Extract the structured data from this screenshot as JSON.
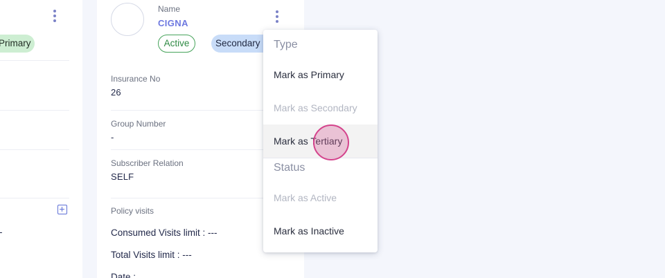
{
  "left_card": {
    "badge_label": "Primary",
    "visits_limit_fragment": "---"
  },
  "main_card": {
    "name_label": "Name",
    "name_value": "CIGNA",
    "status_badge": "Active",
    "type_badge": "Secondary",
    "fields": {
      "insurance_no_label": "Insurance No",
      "insurance_no_value": "26",
      "group_number_label": "Group Number",
      "group_number_value": "-",
      "subscriber_relation_label": "Subscriber Relation",
      "subscriber_relation_value": "SELF",
      "policy_visits_label": "Policy visits"
    },
    "consumed_visits": "Consumed Visits limit : ---",
    "total_visits": "Total Visits limit : ---",
    "date": "Date :"
  },
  "menu": {
    "type_header": "Type",
    "items_type": [
      {
        "label": "Mark as Primary",
        "enabled": true
      },
      {
        "label": "Mark as Secondary",
        "enabled": false
      },
      {
        "label": "Mark as Tertiary",
        "enabled": true,
        "hovered": true
      }
    ],
    "status_header": "Status",
    "items_status": [
      {
        "label": "Mark as Active",
        "enabled": false
      },
      {
        "label": "Mark as Inactive",
        "enabled": true
      }
    ]
  },
  "colors": {
    "accent": "#6e79e0",
    "active_green": "#2f8a44",
    "primary_pill_bg": "#cdeed2",
    "secondary_pill_bg": "#c8dcf8",
    "cursor_ring": "#d4438c"
  },
  "icons": [
    "kebab-menu-icon",
    "add-icon"
  ]
}
